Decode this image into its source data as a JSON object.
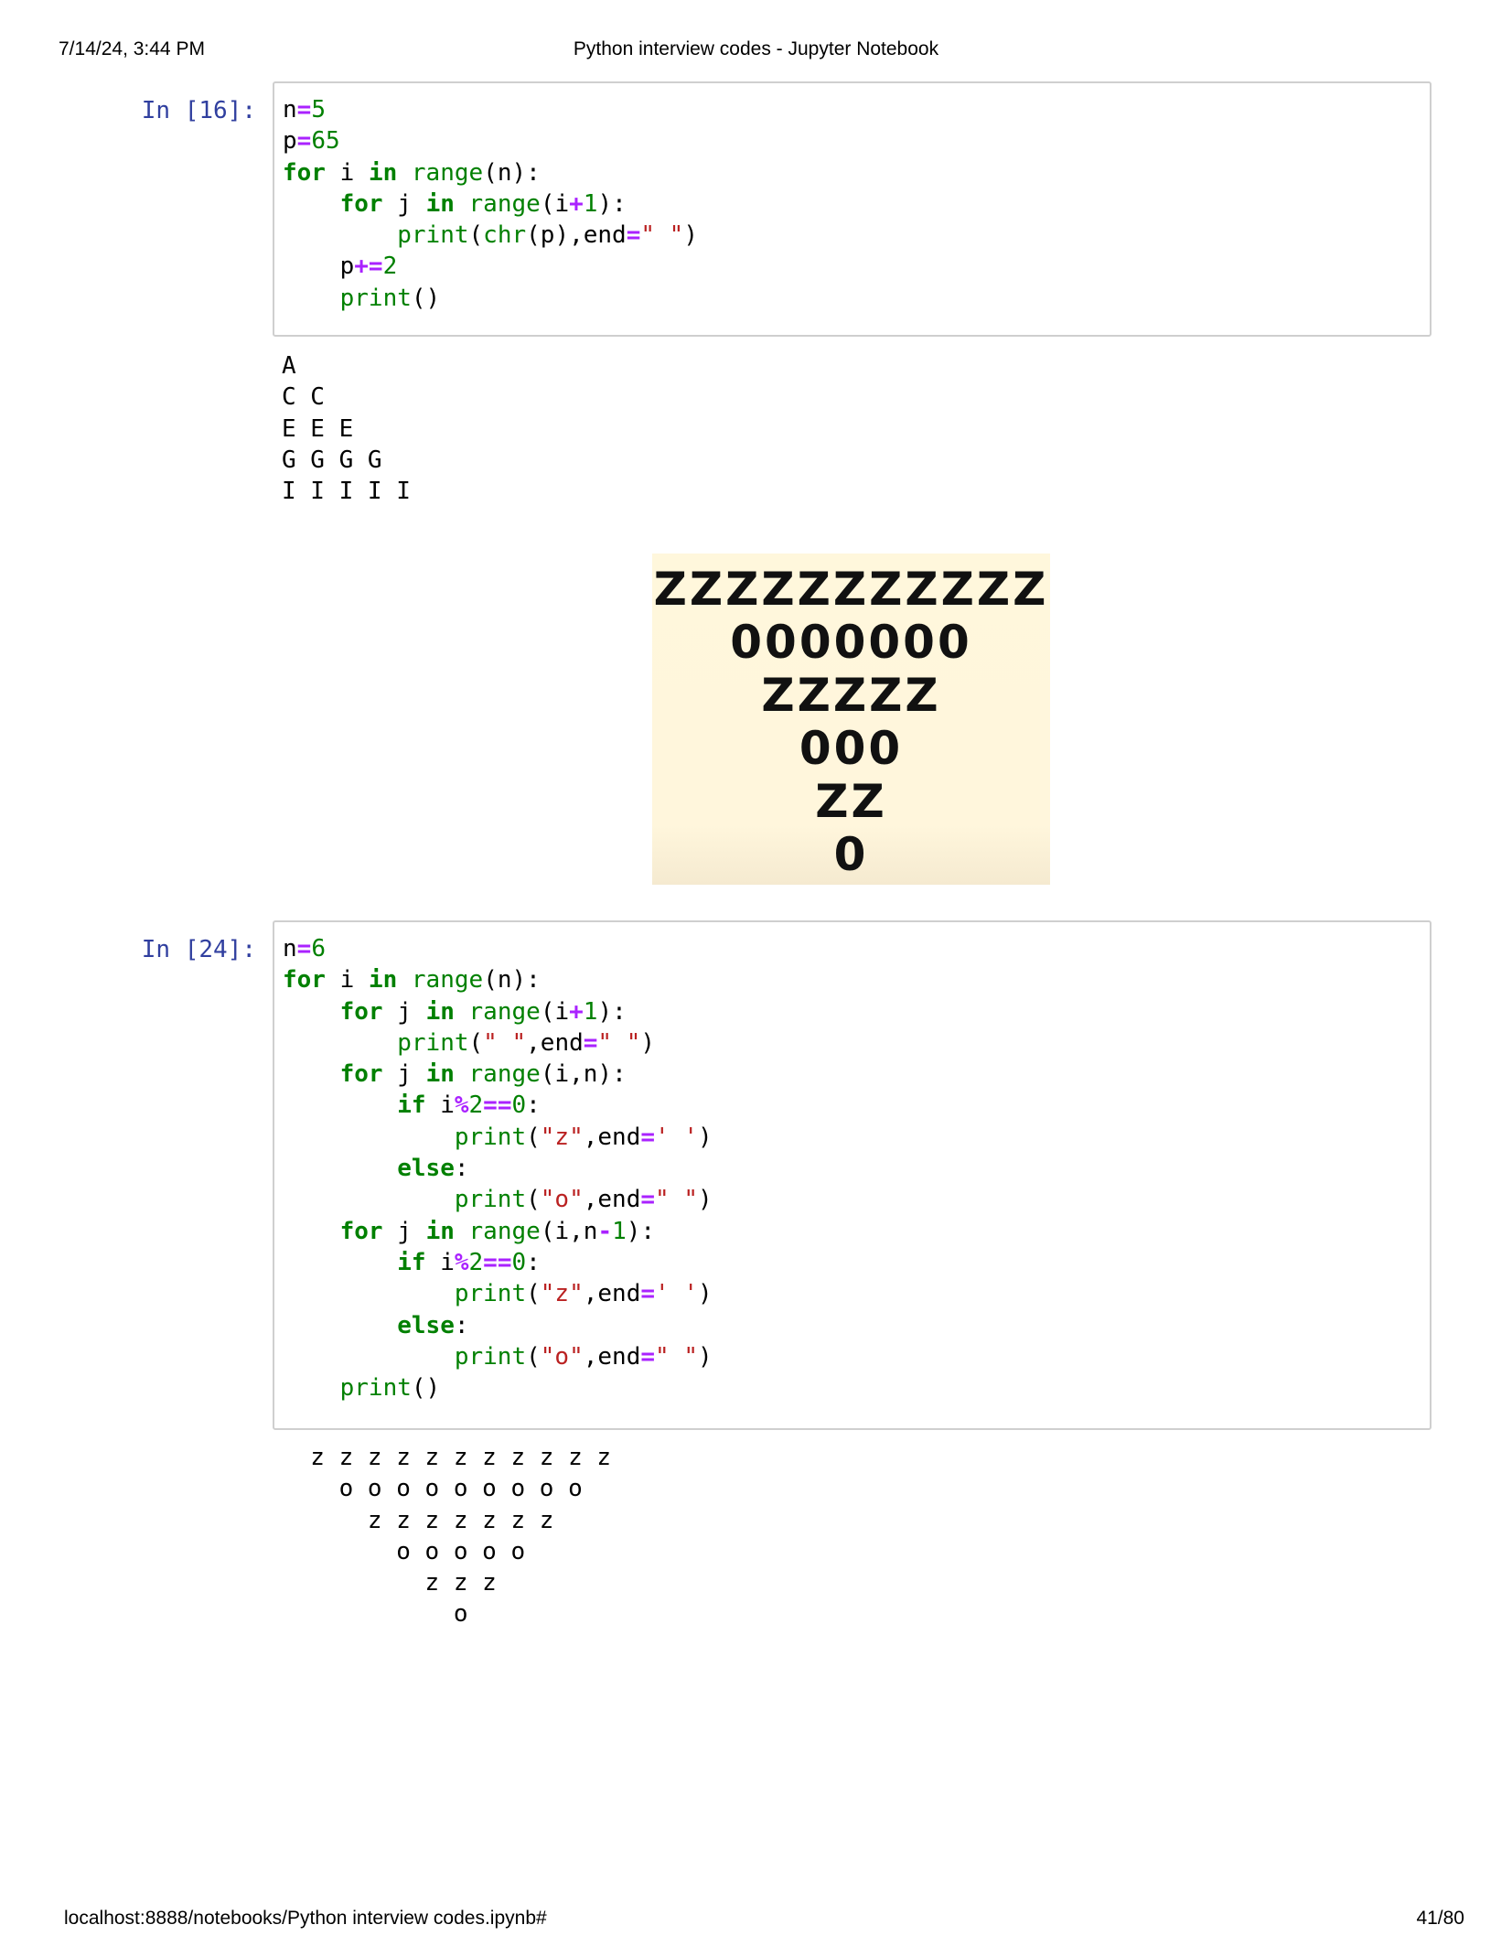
{
  "header": {
    "datetime": "7/14/24, 3:44 PM",
    "title": "Python interview codes - Jupyter Notebook"
  },
  "cells": [
    {
      "prompt": "In [16]:",
      "output": "A\nC C\nE E E\nG G G G\nI I I I I"
    },
    {
      "prompt": "In [24]:",
      "output": "  z z z z z z z z z z z\n    o o o o o o o o o\n      z z z z z z z\n        o o o o o\n          z z z\n            o"
    }
  ],
  "pattern_image": {
    "rows": [
      "ZZZZZZZZZZZ",
      "0000000",
      "ZZZZZ",
      "000",
      "ZZ",
      "0"
    ]
  },
  "footer": {
    "url": "localhost:8888/notebooks/Python interview codes.ipynb#",
    "page": "41/80"
  }
}
